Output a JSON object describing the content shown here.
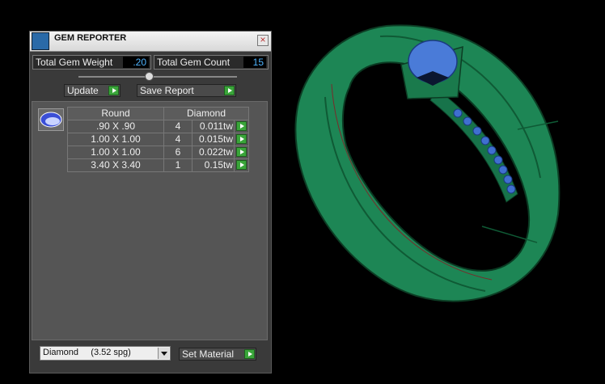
{
  "viewport": {
    "scene": "3d-ring-model",
    "colors": {
      "background": "#000000",
      "ring": "#1f8a57",
      "gem": "#4a7bd8",
      "edge": "#0c3d24"
    }
  },
  "panel": {
    "title": "GEM REPORTER",
    "close_label": "×",
    "stats": {
      "weight_label": "Total Gem Weight",
      "weight_value": ".20",
      "count_label": "Total Gem Count",
      "count_value": "15"
    },
    "buttons": {
      "update_label": "Update",
      "save_label": "Save Report"
    },
    "table": {
      "headers": {
        "shape": "Round",
        "stone": "Diamond"
      },
      "rows": [
        {
          "size": ".90 X .90",
          "qty": "4",
          "weight": "0.011tw"
        },
        {
          "size": "1.00 X 1.00",
          "qty": "4",
          "weight": "0.015tw"
        },
        {
          "size": "1.00 X 1.00",
          "qty": "6",
          "weight": "0.022tw"
        },
        {
          "size": "3.40 X 3.40",
          "qty": "1",
          "weight": "0.15tw"
        }
      ]
    },
    "material": {
      "selected": "Diamond     (3.52 spg)",
      "set_label": "Set Material"
    },
    "colors": {
      "panel": "#3a3a3a",
      "value_text": "#4fb4ff",
      "go_button": "#3aa53a"
    }
  }
}
